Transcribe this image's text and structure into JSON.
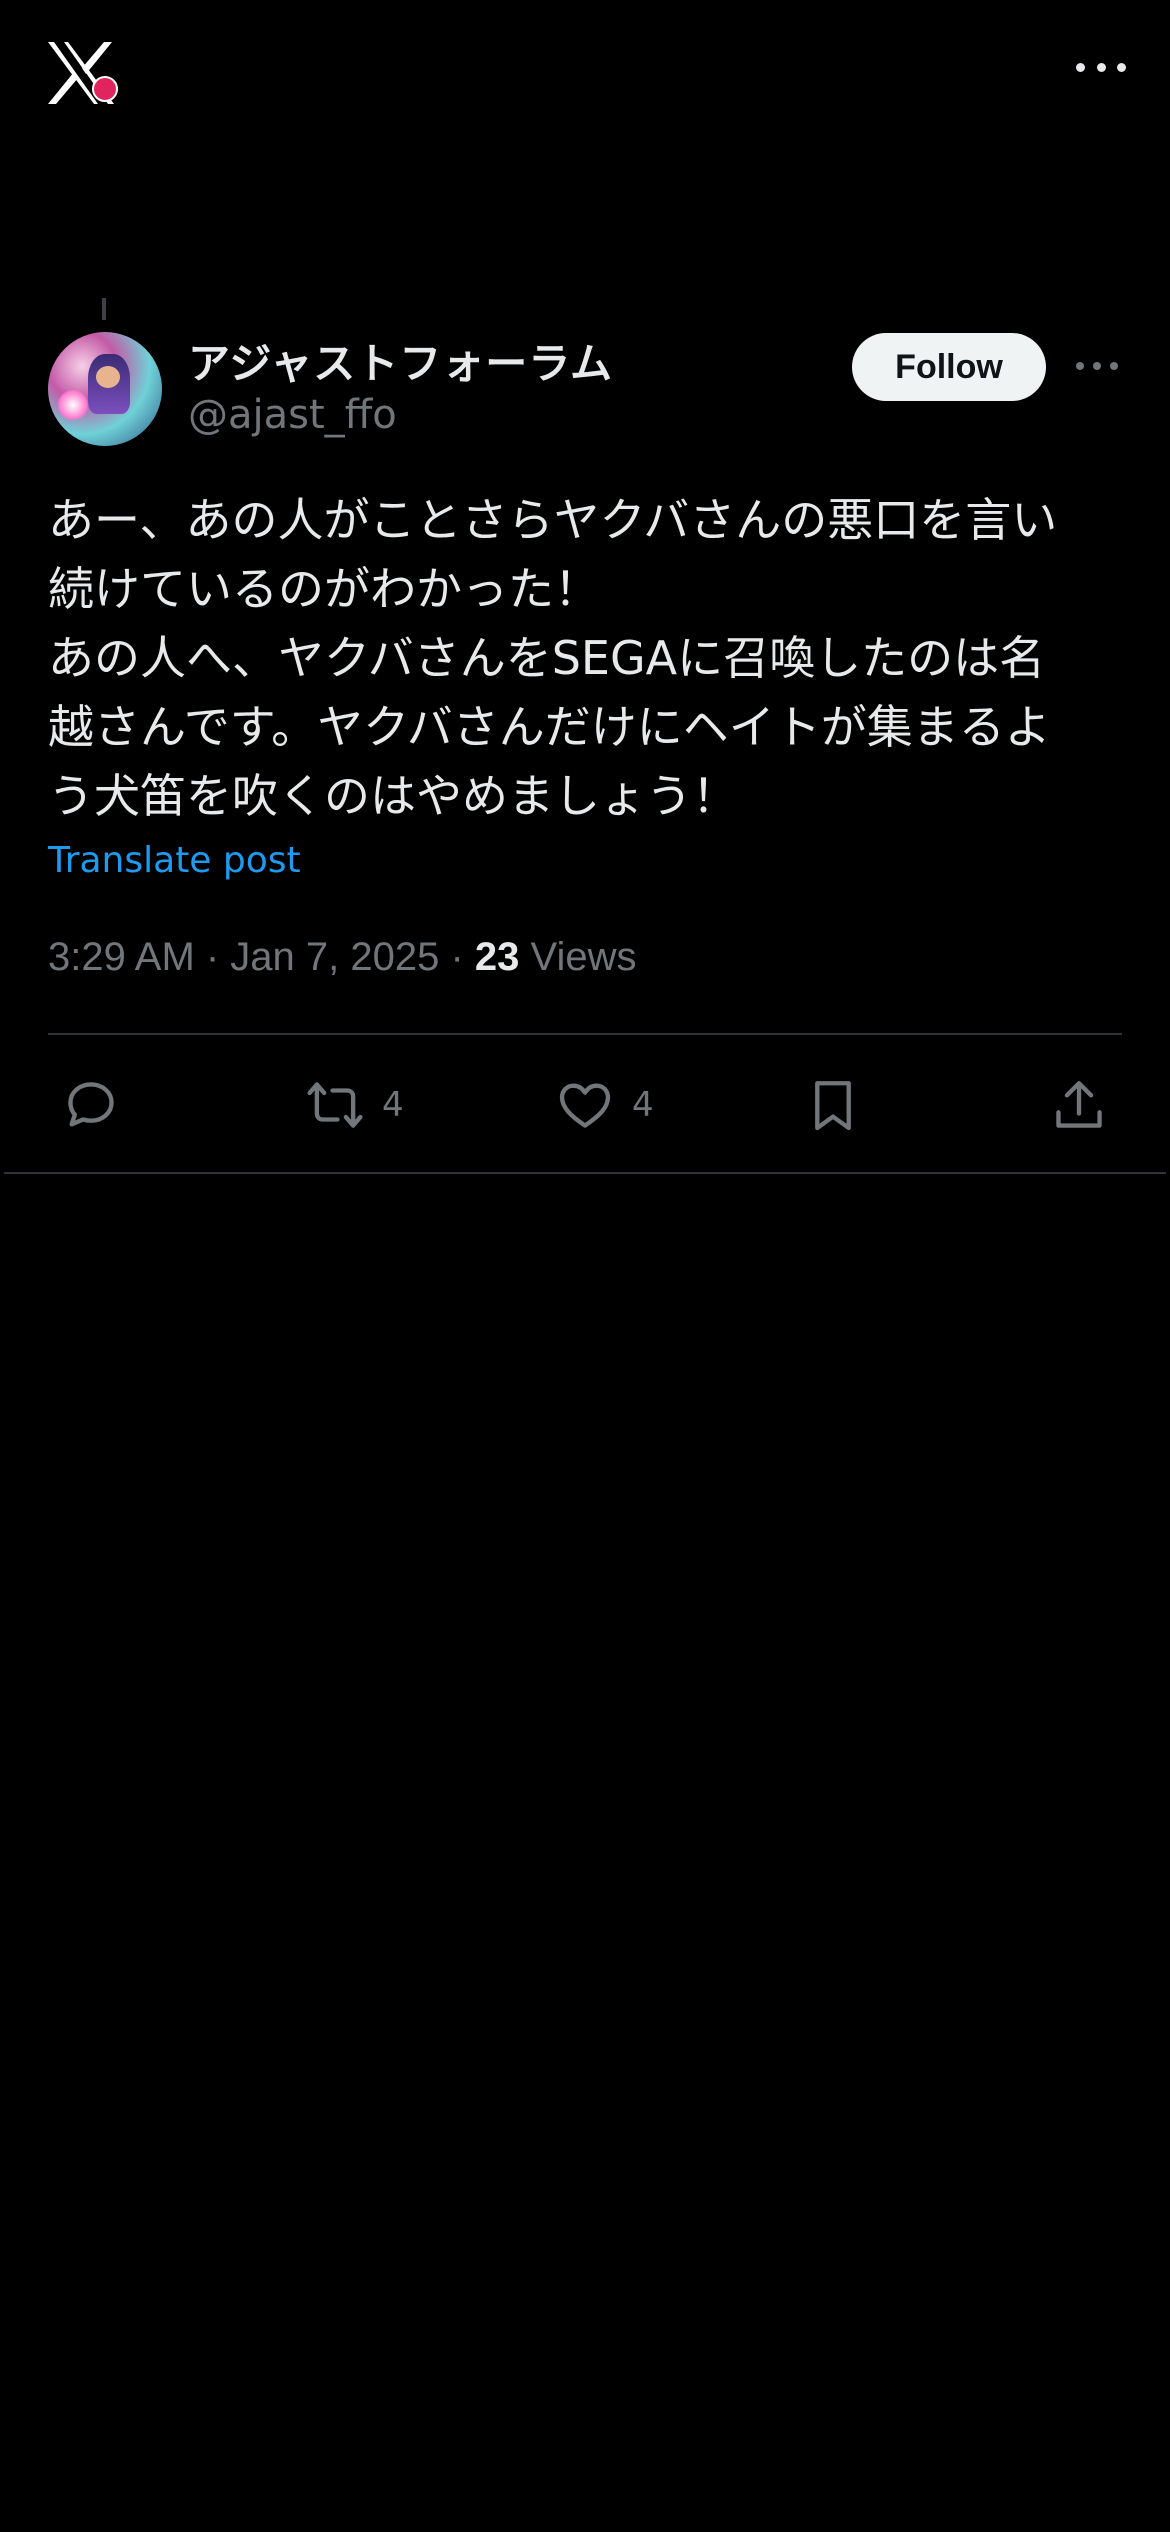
{
  "header": {
    "logo_icon": "x-logo-icon",
    "more_icon": "more-horizontal-icon"
  },
  "post": {
    "author": {
      "display_name": "アジャストフォーラム",
      "handle": "@ajast_ffo"
    },
    "follow_label": "Follow",
    "text": "あー、あの人がことさらヤクバさんの悪口を言い\n続けているのがわかった！\nあの人へ、ヤクバさんをSEGAに召喚したのは名\n越さんです。ヤクバさんだけにヘイトが集まるよ\nう犬笛を吹くのはやめましょう！",
    "translate_label": "Translate post",
    "timestamp": "3:29 AM · Jan 7, 2025 · ",
    "views_count": "23",
    "views_label": " Views",
    "stats": {
      "retweets": "4",
      "likes": "4"
    }
  },
  "colors": {
    "background": "#000000",
    "primary_text": "#e7e9ea",
    "secondary_text": "#71767b",
    "link": "#1d9bf0",
    "follow_bg": "#eff3f4",
    "divider": "#2f3336"
  }
}
